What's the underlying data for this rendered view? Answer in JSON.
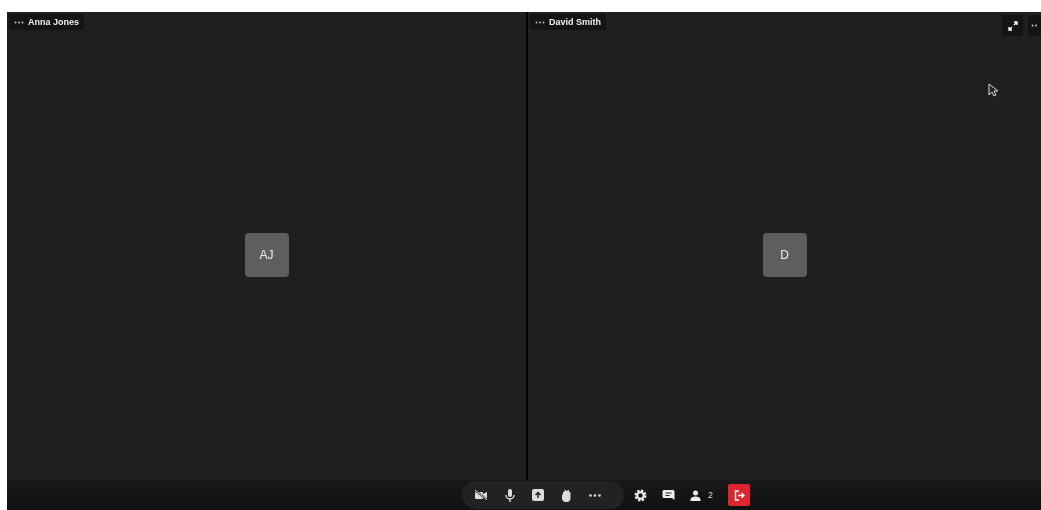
{
  "tiles": [
    {
      "name": "Anna Jones",
      "initials": "AJ"
    },
    {
      "name": "David Smith",
      "initials": "D"
    }
  ],
  "participant_count": "2"
}
